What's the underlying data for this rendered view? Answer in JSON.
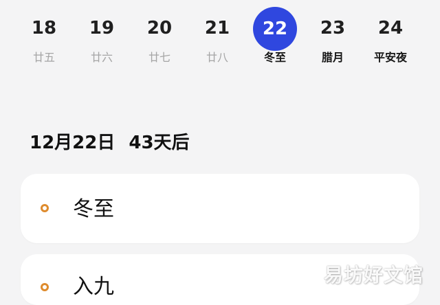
{
  "calendar": {
    "days": [
      {
        "date": "18",
        "label": "廿五",
        "selected": false,
        "emphasis": false
      },
      {
        "date": "19",
        "label": "廿六",
        "selected": false,
        "emphasis": false
      },
      {
        "date": "20",
        "label": "廿七",
        "selected": false,
        "emphasis": false
      },
      {
        "date": "21",
        "label": "廿八",
        "selected": false,
        "emphasis": false
      },
      {
        "date": "22",
        "label": "冬至",
        "selected": true,
        "emphasis": true
      },
      {
        "date": "23",
        "label": "腊月",
        "selected": false,
        "emphasis": true
      },
      {
        "date": "24",
        "label": "平安夜",
        "selected": false,
        "emphasis": true
      }
    ],
    "selected_color": "#2f47df",
    "muted_color": "#a5a5a5",
    "emphasis_color": "#161616"
  },
  "summary": {
    "date": "12月22日",
    "countdown": "43天后"
  },
  "events": [
    {
      "name": "冬至",
      "icon": "hollow-circle-icon",
      "color": "#de8b2d"
    },
    {
      "name": "入九",
      "icon": "hollow-circle-icon",
      "color": "#de8b2d"
    }
  ],
  "watermark": {
    "text": "易坊好文馆"
  }
}
